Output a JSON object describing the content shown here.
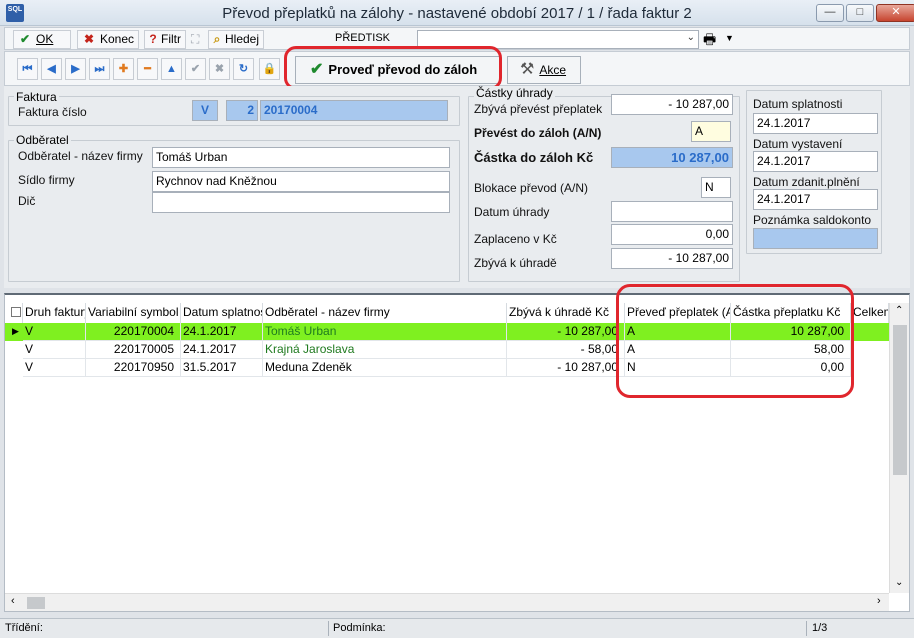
{
  "window": {
    "title": "Převod přeplatků na zálohy  - nastavené období 2017 / 1 / řada faktur 2",
    "app_icon_text": "SQL",
    "controls": {
      "minimize": "—",
      "maximize": "□",
      "close": "✕"
    }
  },
  "toolbar1": {
    "ok_label": "OK",
    "konec_label": "Konec",
    "filtr_label": "Filtr",
    "hledej_label": "Hledej",
    "predtisk_label": "PŘEDTISK",
    "predtisk_value": ""
  },
  "toolbar2": {
    "nav_icons": [
      "first-record-icon",
      "previous-record-icon",
      "next-record-icon",
      "last-record-icon",
      "add-record-icon",
      "delete-record-icon",
      "up-icon",
      "confirm-icon",
      "cancel-icon",
      "refresh-icon",
      "lock-icon"
    ],
    "provest_label": "Proveď převod do záloh",
    "akce_label": "Akce"
  },
  "faktura": {
    "group_label": "Faktura",
    "cislo_label": "Faktura číslo",
    "druh": "V",
    "rada": "2",
    "cislo": "20170004"
  },
  "odberatel": {
    "group_label": "Odběratel",
    "nazev_label": "Odběratel - název firmy",
    "nazev_value": "Tomáš Urban",
    "sidlo_label": "Sídlo firmy",
    "sidlo_value": "Rychnov nad Kněžnou",
    "dic_label": "Dič",
    "dic_value": ""
  },
  "castky": {
    "group_label": "Částky úhrady",
    "zbyva_prevest_label": "Zbývá převést přeplatek",
    "zbyva_prevest_value": "- 10 287,00",
    "prevest_label": "Převést do záloh (A/N)",
    "prevest_value": "A",
    "castka_label": "Částka do záloh Kč",
    "castka_value": "10 287,00",
    "blokace_label": "Blokace převod (A/N)",
    "blokace_value": "N",
    "datum_uhrady_label": "Datum úhrady",
    "datum_uhrady_value": "",
    "zaplaceno_label": "Zaplaceno v Kč",
    "zaplaceno_value": "0,00",
    "zbyva_uhrade_label": "Zbývá k úhradě",
    "zbyva_uhrade_value": "- 10 287,00"
  },
  "datumy": {
    "splatnosti_label": "Datum splatnosti",
    "splatnosti_value": "24.1.2017",
    "vystaveni_label": "Datum vystavení",
    "vystaveni_value": "24.1.2017",
    "zdanit_label": "Datum zdanit.plnění",
    "zdanit_value": "24.1.2017",
    "poznamka_label": "Poznámka saldokonto",
    "poznamka_value": ""
  },
  "grid": {
    "columns": [
      "Druh faktury",
      "Variabilní symbol",
      "Datum splatnosti",
      "Odběratel - název firmy",
      "Zbývá k úhradě Kč",
      "Převeď přeplatek (A.",
      "Částka přeplatku Kč",
      "Celkem"
    ],
    "rows": [
      [
        "V",
        "220170004",
        "24.1.2017",
        "Tomáš Urban",
        "- 10 287,00",
        "A",
        "10 287,00"
      ],
      [
        "V",
        "220170005",
        "24.1.2017",
        "Krajná Jaroslava",
        "- 58,00",
        "A",
        "58,00"
      ],
      [
        "V",
        "220170950",
        "31.5.2017",
        "Meduna Zdeněk",
        "- 10 287,00",
        "N",
        "0,00"
      ]
    ],
    "selected_row": 0
  },
  "status": {
    "trideni_label": "Třídění:",
    "podminka_label": "Podmínka:",
    "record_count": "1/3"
  },
  "colors": {
    "selected_row": "#7ff020",
    "highlight_ring": "#e0262d",
    "blue_field": "#a8c8ee"
  }
}
